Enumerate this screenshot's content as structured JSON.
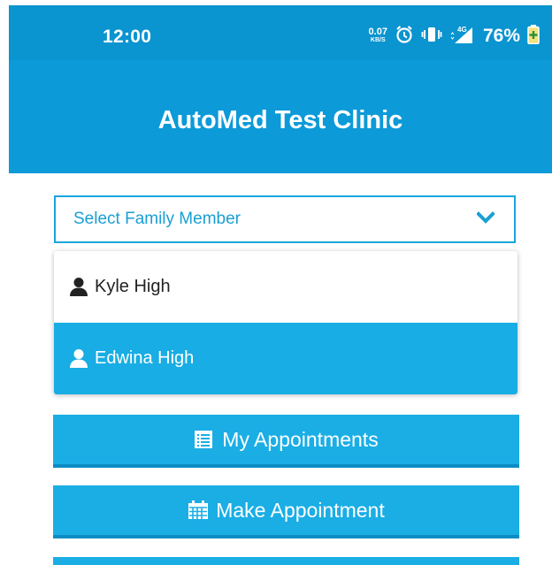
{
  "status_bar": {
    "time": "12:00",
    "net_speed_value": "0.07",
    "net_speed_unit": "KB/S",
    "icons": [
      "alarm-icon",
      "vibrate-icon",
      "4g-signal-icon",
      "battery-icon"
    ],
    "battery_percent": "76%"
  },
  "header": {
    "title": "AutoMed Test Clinic"
  },
  "family_select": {
    "placeholder": "Select Family Member",
    "options": [
      {
        "label": "Kyle High",
        "icon": "user-icon",
        "selected": false
      },
      {
        "label": "Edwina High",
        "icon": "user-icon",
        "selected": true
      }
    ]
  },
  "menu": {
    "my_appointments": {
      "label": "My Appointments",
      "icon": "list-icon"
    },
    "make_appointment": {
      "label": "Make Appointment",
      "icon": "calendar-icon"
    }
  },
  "colors": {
    "status_bar": "#0a94d0",
    "header": "#0c9ad8",
    "accent": "#1aaee5",
    "button_shadow": "#0b8cc3"
  }
}
